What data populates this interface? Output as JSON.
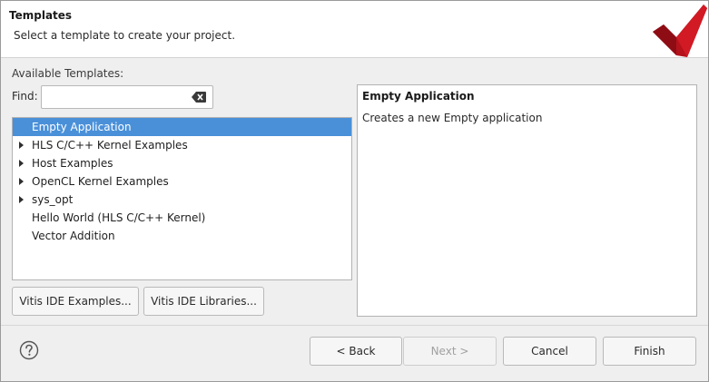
{
  "header": {
    "title": "Templates",
    "description": "Select a template to create your project."
  },
  "templates": {
    "section_label": "Available Templates:",
    "find_label": "Find:",
    "find_value": "",
    "find_placeholder": "",
    "items": [
      {
        "label": "Empty Application",
        "expandable": false,
        "selected": true
      },
      {
        "label": "HLS C/C++ Kernel Examples",
        "expandable": true,
        "selected": false
      },
      {
        "label": "Host Examples",
        "expandable": true,
        "selected": false
      },
      {
        "label": "OpenCL Kernel Examples",
        "expandable": true,
        "selected": false
      },
      {
        "label": "sys_opt",
        "expandable": true,
        "selected": false
      },
      {
        "label": "Hello World (HLS C/C++ Kernel)",
        "expandable": false,
        "selected": false
      },
      {
        "label": "Vector Addition",
        "expandable": false,
        "selected": false
      }
    ],
    "examples_button": "Vitis IDE Examples...",
    "libraries_button": "Vitis IDE Libraries..."
  },
  "details": {
    "title": "Empty Application",
    "text": "Creates a new Empty application"
  },
  "footer": {
    "help_icon": "question-circle-icon",
    "back_label": "< Back",
    "next_label": "Next >",
    "cancel_label": "Cancel",
    "finish_label": "Finish"
  },
  "colors": {
    "selection": "#4a90d9",
    "logo": "#b5121b"
  }
}
